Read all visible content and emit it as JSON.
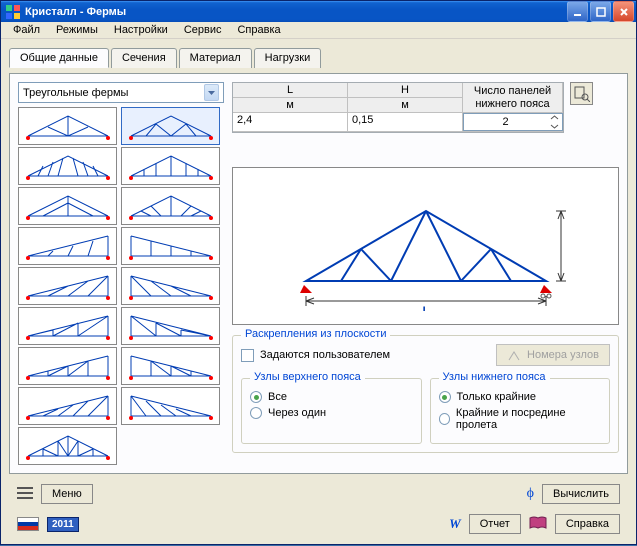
{
  "titlebar": {
    "title": "Кристалл - Фермы"
  },
  "menu": {
    "items": [
      "Файл",
      "Режимы",
      "Настройки",
      "Сервис",
      "Справка"
    ]
  },
  "tabs": {
    "items": [
      "Общие данные",
      "Сечения",
      "Материал",
      "Нагрузки"
    ],
    "active": 0
  },
  "combo": {
    "selected": "Треугольные фермы"
  },
  "params": {
    "L": {
      "label": "L",
      "unit": "м",
      "value": "2,4"
    },
    "H": {
      "label": "H",
      "unit": "м",
      "value": "0,15"
    },
    "panels": {
      "label": "Число панелей нижнего пояса",
      "value": "2"
    }
  },
  "bracing": {
    "group_title": "Раскрепления из плоскости",
    "user_defined_label": "Задаются пользователем",
    "nodes_btn": "Номера узлов",
    "top": {
      "title": "Узлы верхнего пояса",
      "opts": [
        "Все",
        "Через один"
      ],
      "sel": 0
    },
    "bottom": {
      "title": "Узлы нижнего пояса",
      "opts": [
        "Только крайние",
        "Крайние и посредине пролета"
      ],
      "sel": 0
    }
  },
  "buttons": {
    "menu": "Меню",
    "compute": "Вычислить",
    "report": "Отчет",
    "help": "Справка"
  },
  "year": "2011"
}
